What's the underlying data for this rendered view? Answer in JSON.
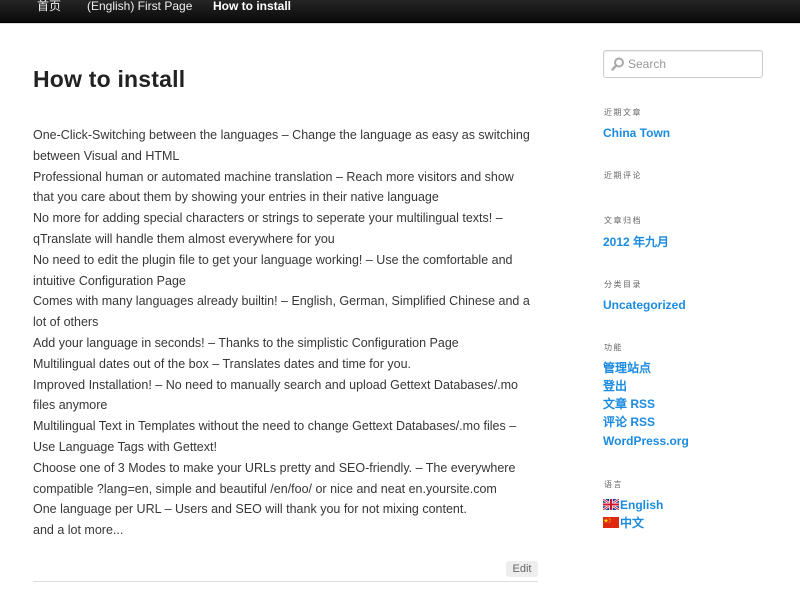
{
  "nav": {
    "items": [
      {
        "label": "首页"
      },
      {
        "label": "(English) First Page"
      },
      {
        "label": "How to install"
      }
    ]
  },
  "post": {
    "title": "How to install",
    "lines": [
      "One-Click-Switching between the languages – Change the language as easy as switching",
      "between Visual and HTML",
      "Professional human or automated machine translation – Reach more visitors and show",
      "that you care about them by showing your entries in their native language",
      "No more for adding special characters or strings to seperate your multilingual texts! –",
      "qTranslate will handle them almost everywhere for you",
      "No need to edit the plugin file to get your language working! – Use the comfortable and",
      "intuitive Configuration Page",
      "Comes with many languages already builtin! – English, German, Simplified Chinese and a",
      "lot of others",
      "Add your language in seconds! – Thanks to the simplistic Configuration Page",
      "Multilingual dates out of the box – Translates dates and time for you.",
      "Improved Installation! – No need to manually search and upload Gettext Databases/.mo",
      "files anymore",
      "Multilingual Text in Templates without the need to change Gettext Databases/.mo files –",
      "Use Language Tags with Gettext!",
      "Choose one of 3 Modes to make your URLs pretty and SEO-friendly. – The everywhere",
      "compatible ?lang=en, simple and beautiful /en/foo/ or nice and neat en.yoursite.com",
      "One language per URL – Users and SEO will thank you for not mixing content.",
      "and a lot more..."
    ],
    "edit_label": "Edit"
  },
  "sidebar": {
    "search_placeholder": "Search",
    "recent_posts": {
      "title": "近期文章",
      "items": [
        "China Town"
      ]
    },
    "recent_comments": {
      "title": "近期评论"
    },
    "archives": {
      "title": "文章归档",
      "items": [
        "2012 年九月"
      ]
    },
    "categories": {
      "title": "分类目录",
      "items": [
        "Uncategorized"
      ]
    },
    "meta": {
      "title": "功能",
      "items": [
        "管理站点",
        "登出",
        "文章 RSS",
        "评论 RSS",
        "WordPress.org"
      ]
    },
    "languages": {
      "title": "语言",
      "items": [
        "English",
        "中文"
      ]
    }
  },
  "colors": {
    "link": "#1b8be0",
    "nav_background": "#0a0a0a",
    "text": "#373737"
  }
}
